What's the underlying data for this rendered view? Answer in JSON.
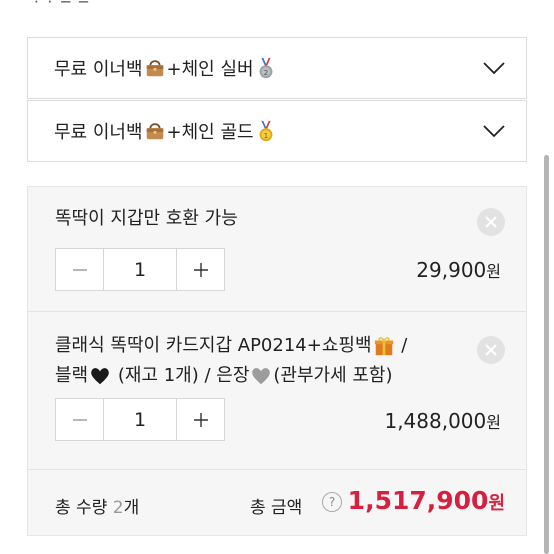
{
  "header": {
    "stub_text": "· · ─ ─"
  },
  "options": [
    {
      "prefix": "무료 이너백",
      "suffix": "+체인 실버",
      "bag_icon": "handbag-icon",
      "medal_icon": "silver-medal-icon"
    },
    {
      "prefix": "무료 이너백",
      "suffix": "+체인 골드",
      "bag_icon": "handbag-icon",
      "medal_icon": "gold-medal-icon"
    }
  ],
  "cart": {
    "items": [
      {
        "line1": "똑딱이 지갑만 호환 가능",
        "qty": "1",
        "price": "29,900",
        "unit": "원"
      },
      {
        "line1_a": "클래식 똑딱이 카드지갑 AP0214+쇼핑백",
        "line1_b": " /",
        "line2_a": "블랙",
        "line2_b": " (재고 1개) / 은장",
        "line2_c": "(관부가세 포함)",
        "qty": "1",
        "price": "1,488,000",
        "unit": "원"
      }
    ],
    "total_count_label": "총 수량 ",
    "total_count_value": "2",
    "total_count_unit": "개",
    "total_amount_label": "총 금액",
    "help_glyph": "?",
    "total_price": "1,517,900",
    "total_unit": "원"
  },
  "colors": {
    "accent_red": "#d5213f",
    "box_bg": "#f6f6f6",
    "border": "#dcdcdc"
  }
}
